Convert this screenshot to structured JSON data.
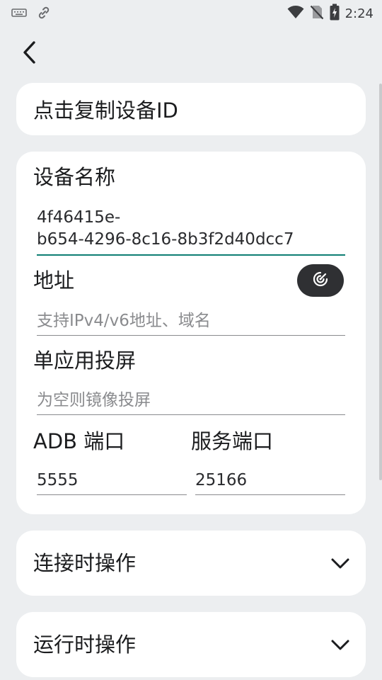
{
  "status_bar": {
    "time": "2:24",
    "icons": [
      "keyboard-icon",
      "link-icon",
      "wifi-icon",
      "no-sim-icon",
      "battery-charging-icon"
    ]
  },
  "nav": {
    "back_icon": "back-arrow-icon"
  },
  "copy_card": {
    "label": "点击复制设备ID"
  },
  "form": {
    "device_name_label": "设备名称",
    "device_name_value_line1": "4f46415e-",
    "device_name_value_line2": "b654-4296-8c16-8b3f2d40dcc7",
    "address_label": "地址",
    "address_placeholder": "支持IPv4/v6地址、域名",
    "scan_icon": "scan-icon",
    "single_app_label": "单应用投屏",
    "single_app_placeholder": "为空则镜像投屏",
    "adb_port_label": "ADB 端口",
    "adb_port_value": "5555",
    "service_port_label": "服务端口",
    "service_port_value": "25166"
  },
  "sections": {
    "on_connect": "连接时操作",
    "on_run": "运行时操作"
  },
  "colors": {
    "background": "#eceef0",
    "card": "#ffffff",
    "accent": "#0f7e74",
    "scan_button": "#2f3033"
  }
}
